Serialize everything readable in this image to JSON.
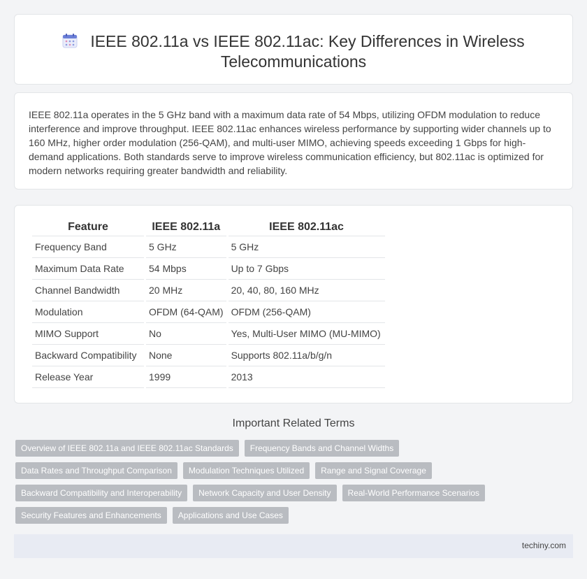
{
  "header": {
    "icon": "calendar-icon",
    "title": "IEEE 802.11a vs IEEE 802.11ac: Key Differences in Wireless Telecommunications"
  },
  "intro": {
    "text": "IEEE 802.11a operates in the 5 GHz band with a maximum data rate of 54 Mbps, utilizing OFDM modulation to reduce interference and improve throughput. IEEE 802.11ac enhances wireless performance by supporting wider channels up to 160 MHz, higher order modulation (256-QAM), and multi-user MIMO, achieving speeds exceeding 1 Gbps for high-demand applications. Both standards serve to improve wireless communication efficiency, but 802.11ac is optimized for modern networks requiring greater bandwidth and reliability."
  },
  "table": {
    "headers": [
      "Feature",
      "IEEE 802.11a",
      "IEEE 802.11ac"
    ],
    "rows": [
      [
        "Frequency Band",
        "5 GHz",
        "5 GHz"
      ],
      [
        "Maximum Data Rate",
        "54 Mbps",
        "Up to 7 Gbps"
      ],
      [
        "Channel Bandwidth",
        "20 MHz",
        "20, 40, 80, 160 MHz"
      ],
      [
        "Modulation",
        "OFDM (64-QAM)",
        "OFDM (256-QAM)"
      ],
      [
        "MIMO Support",
        "No",
        "Yes, Multi-User MIMO (MU-MIMO)"
      ],
      [
        "Backward Compatibility",
        "None",
        "Supports 802.11a/b/g/n"
      ],
      [
        "Release Year",
        "1999",
        "2013"
      ]
    ]
  },
  "related": {
    "title": "Important Related Terms",
    "tags": [
      "Overview of IEEE 802.11a and IEEE 802.11ac Standards",
      "Frequency Bands and Channel Widths",
      "Data Rates and Throughput Comparison",
      "Modulation Techniques Utilized",
      "Range and Signal Coverage",
      "Backward Compatibility and Interoperability",
      "Network Capacity and User Density",
      "Real-World Performance Scenarios",
      "Security Features and Enhancements",
      "Applications and Use Cases"
    ]
  },
  "footer": {
    "site": "techiny.com"
  },
  "colors": {
    "tag_bg": "#b9bcc1",
    "footer_bg": "#e8ebf3",
    "icon_accent": "#6b7fd7"
  }
}
